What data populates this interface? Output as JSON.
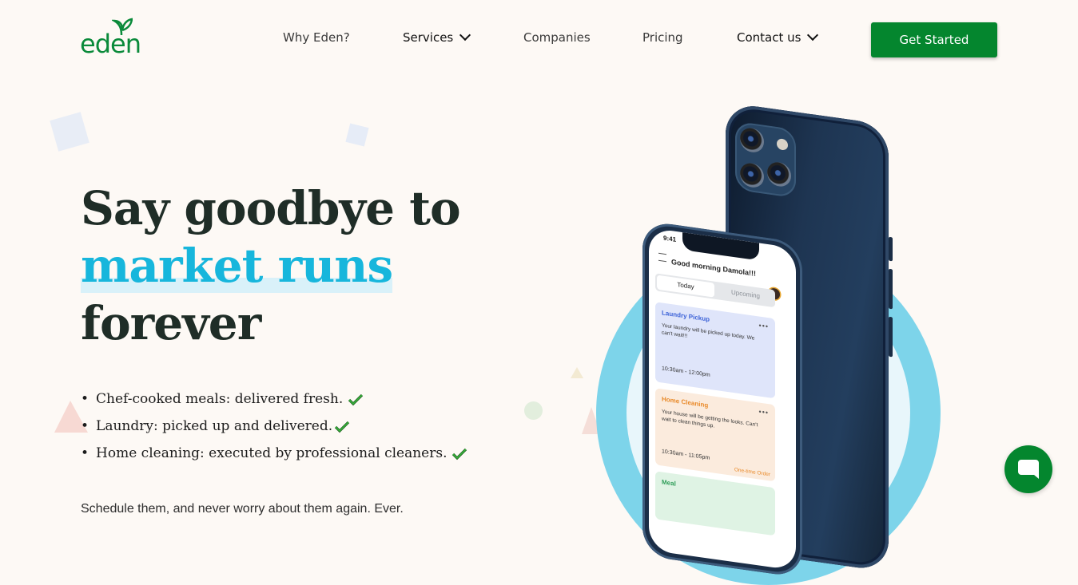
{
  "brand": {
    "name": "eden",
    "color": "#0a8a3a",
    "accent": "#04862e",
    "highlight": "#17b6dc"
  },
  "nav": {
    "items": [
      {
        "label": "Why Eden?",
        "dropdown": false
      },
      {
        "label": "Services",
        "dropdown": true
      },
      {
        "label": "Companies",
        "dropdown": false
      },
      {
        "label": "Pricing",
        "dropdown": false
      },
      {
        "label": "Contact us",
        "dropdown": true
      }
    ],
    "cta_label": "Get Started"
  },
  "hero": {
    "headline_line1": "Say goodbye to",
    "headline_highlight": "market runs",
    "headline_line3": "forever",
    "features": [
      "Chef-cooked meals: delivered fresh.",
      "Laundry: picked up and delivered.",
      "Home cleaning: executed by professional cleaners."
    ],
    "subtext": "Schedule them, and never worry about them again. Ever."
  },
  "phone": {
    "time": "9:41",
    "greeting": "Good morning Damola!!!",
    "tab_today": "Today",
    "tab_upcoming": "Upcoming",
    "cards": [
      {
        "title": "Laundry Pickup",
        "body": "Your laundry will be picked up today. We can't wait!!!",
        "time": "10:30am - 12:00pm",
        "tag": ""
      },
      {
        "title": "Home Cleaning",
        "body": "Your house will be getting the looks. Can't wait to clean things up.",
        "time": "10:30am - 11:05pm",
        "tag": "One-time Order"
      },
      {
        "title": "Meal",
        "body": "",
        "time": "",
        "tag": ""
      }
    ]
  },
  "icons": {
    "chat": "chat-bubble-icon",
    "check": "check-icon",
    "logo_leaf": "leaf-icon"
  }
}
